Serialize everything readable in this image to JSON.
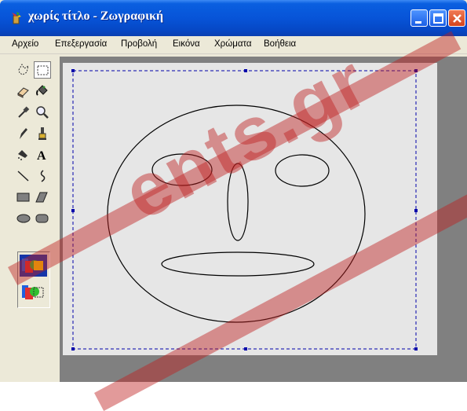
{
  "window": {
    "title": "χωρίς τίτλο - Ζωγραφική",
    "app_icon": "paint-bucket-icon",
    "controls": [
      "minimize-icon",
      "maximize-icon",
      "close-icon"
    ]
  },
  "menu": {
    "items": [
      "Αρχείο",
      "Επεξεργασία",
      "Προβολή",
      "Εικόνα",
      "Χρώματα",
      "Βοήθεια"
    ]
  },
  "toolbox": {
    "tools": [
      {
        "name": "free-form-select-icon",
        "selected": false
      },
      {
        "name": "rect-select-icon",
        "selected": true
      },
      {
        "name": "eraser-icon",
        "selected": false
      },
      {
        "name": "fill-with-color-icon",
        "selected": false
      },
      {
        "name": "pick-color-icon",
        "selected": false
      },
      {
        "name": "magnifier-icon",
        "selected": false
      },
      {
        "name": "pencil-icon",
        "selected": false
      },
      {
        "name": "brush-icon",
        "selected": false
      },
      {
        "name": "airbrush-icon",
        "selected": false
      },
      {
        "name": "text-icon",
        "selected": false
      },
      {
        "name": "line-icon",
        "selected": false
      },
      {
        "name": "curve-icon",
        "selected": false
      },
      {
        "name": "rectangle-icon",
        "selected": false
      },
      {
        "name": "polygon-icon",
        "selected": false
      },
      {
        "name": "ellipse-icon",
        "selected": false
      },
      {
        "name": "rounded-rectangle-icon",
        "selected": false
      }
    ],
    "text_tool_glyph": "A",
    "options": [
      "opaque-background-icon",
      "transparent-background-icon"
    ]
  },
  "canvas": {
    "background": "#e6e6e6",
    "drawing": "face made of ellipses"
  },
  "watermark": {
    "text": "ents.gr",
    "color": "#be1e1e"
  },
  "colors": {
    "titlebar": "#0754d8",
    "workspace": "#808080",
    "selection": "#0000aa"
  }
}
